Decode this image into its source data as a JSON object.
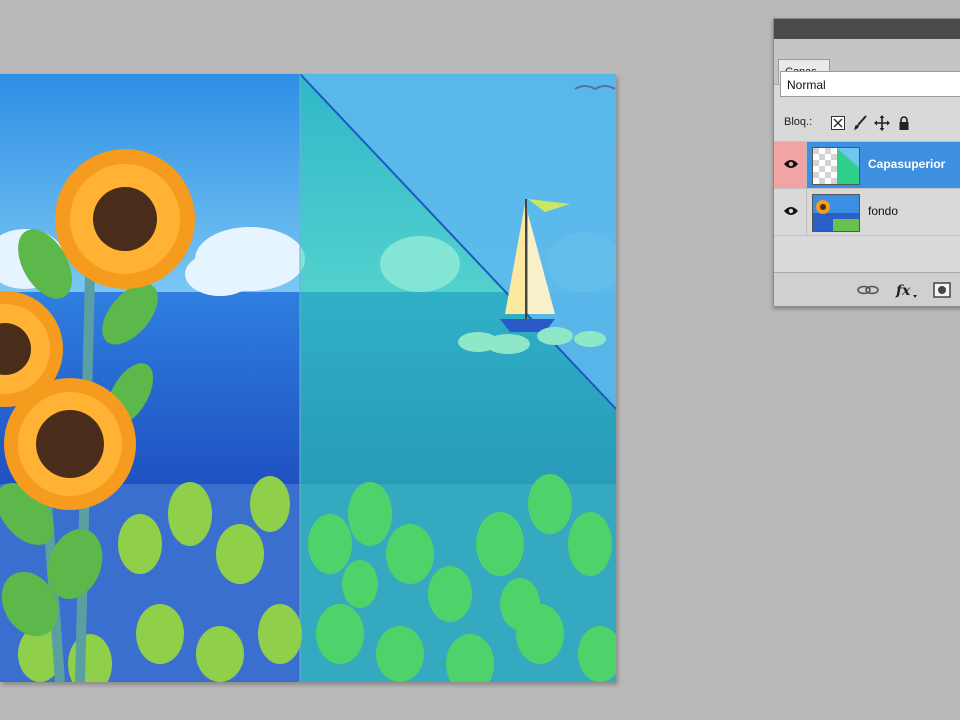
{
  "layers_panel": {
    "tab_label": "Capas",
    "blend_mode": "Normal",
    "lock_label": "Bloq.:",
    "layers": [
      {
        "name": "Capasuperior",
        "selected": true,
        "visible": true
      },
      {
        "name": "fondo",
        "selected": false,
        "visible": true
      }
    ],
    "footer_icons": [
      "link-icon",
      "fx-icon",
      "mask-icon"
    ],
    "lock_icons": [
      "lock-transparent-icon",
      "lock-brush-icon",
      "lock-move-icon",
      "lock-all-icon"
    ]
  },
  "canvas": {
    "description_elements": [
      "sunflowers",
      "sea",
      "sky",
      "clouds",
      "sailboat",
      "grass"
    ]
  },
  "colors": {
    "selection_blue": "#3d8fe0",
    "eye_cell_highlight": "#f2a3a3",
    "workspace_gray": "#b9b9b9"
  }
}
